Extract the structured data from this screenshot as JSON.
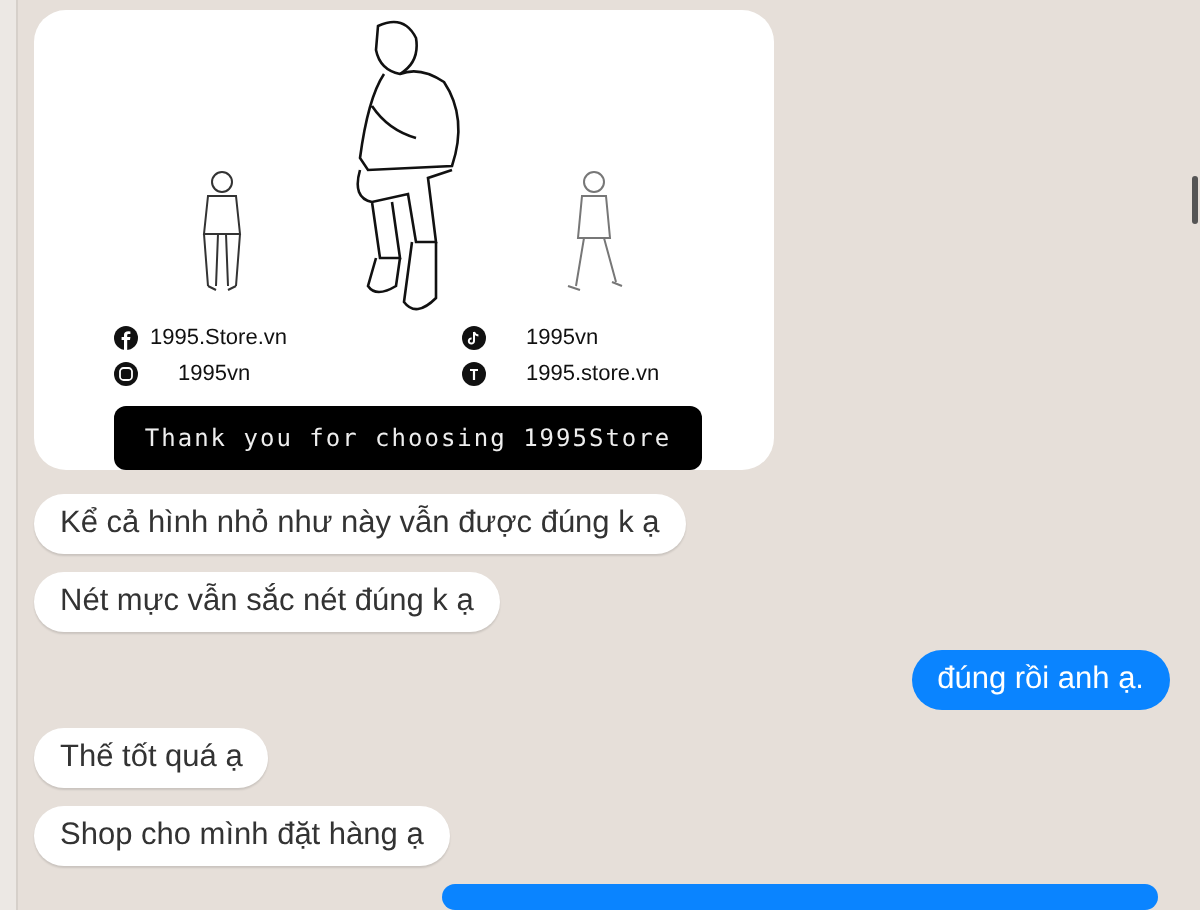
{
  "messages": [
    {
      "kind": "image",
      "card": {
        "socials": [
          {
            "kind": "facebook",
            "text": "1995.Store.vn"
          },
          {
            "kind": "tiktok",
            "text": "1995vn"
          },
          {
            "kind": "instagram",
            "text": "1995vn"
          },
          {
            "kind": "threads",
            "text": "1995.store.vn"
          }
        ],
        "banner": "Thank you for choosing 1995Store"
      }
    },
    {
      "kind": "incoming",
      "text": "Kể cả hình nhỏ như này vẫn được đúng k ạ"
    },
    {
      "kind": "incoming",
      "text": "Nét mực vẫn sắc nét đúng k ạ"
    },
    {
      "kind": "outgoing",
      "text": "đúng rồi anh ạ."
    },
    {
      "kind": "incoming",
      "text": "Thế tốt quá ạ"
    },
    {
      "kind": "incoming",
      "text": "Shop cho mình đặt hàng ạ"
    },
    {
      "kind": "outgoing-cut"
    }
  ]
}
